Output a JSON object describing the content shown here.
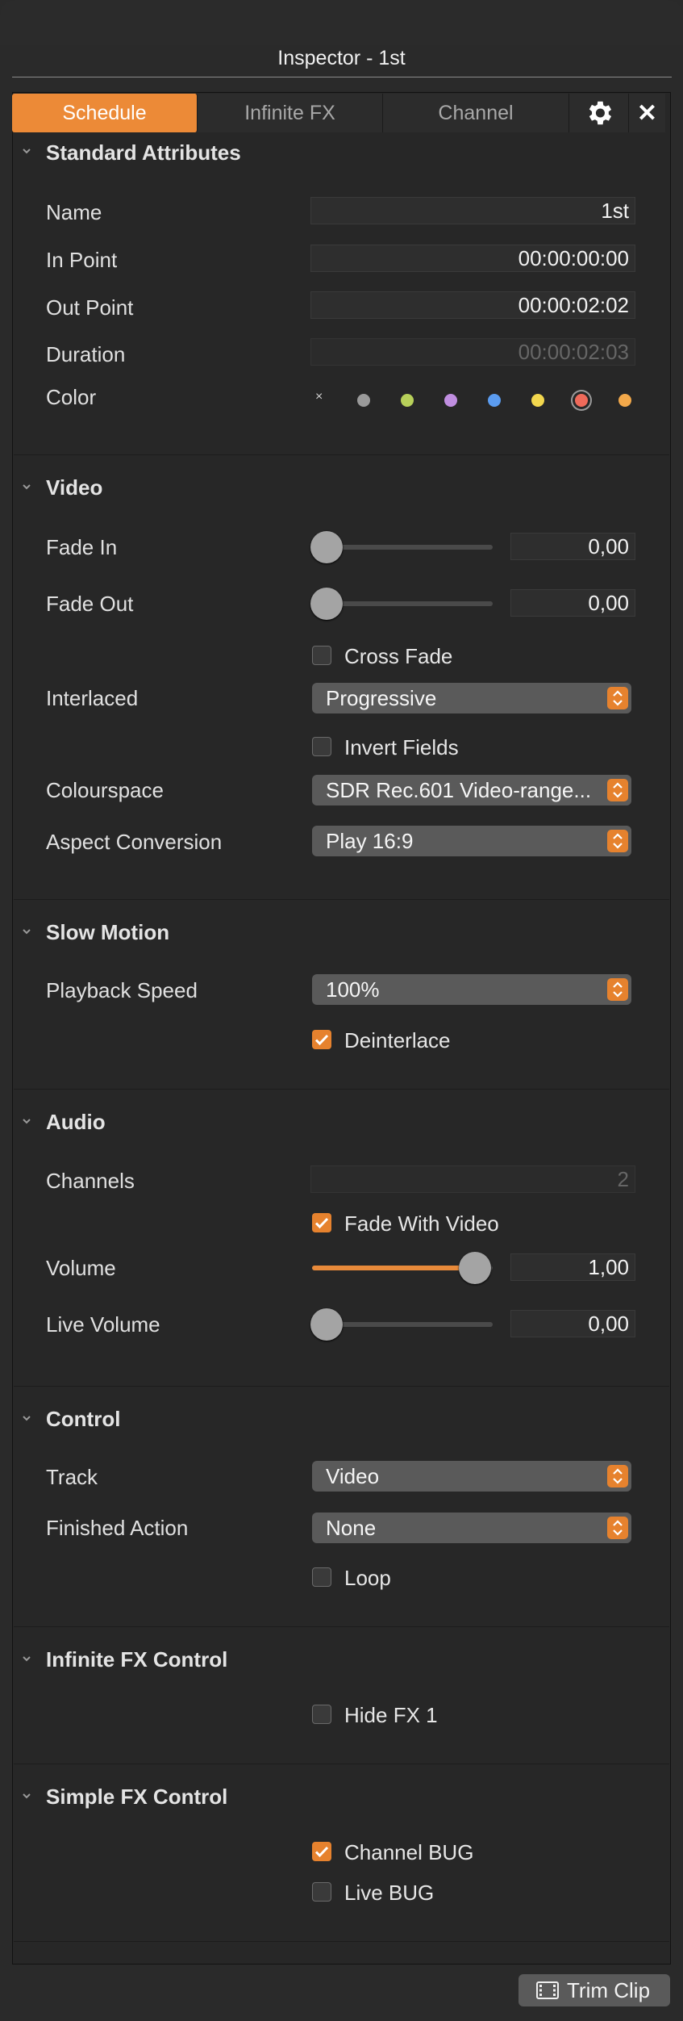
{
  "window": {
    "title": "Inspector - 1st"
  },
  "tabs": [
    {
      "label": "Schedule",
      "active": true
    },
    {
      "label": "Infinite FX",
      "active": false
    },
    {
      "label": "Channel",
      "active": false
    }
  ],
  "tab_icons": {
    "settings": "gear-icon",
    "close": "close-icon",
    "close_glyph": "✕"
  },
  "standard": {
    "title": "Standard Attributes",
    "name_label": "Name",
    "name_value": "1st",
    "in_label": "In Point",
    "in_value": "00:00:00:00",
    "out_label": "Out Point",
    "out_value": "00:00:02:02",
    "duration_label": "Duration",
    "duration_value": "00:00:02:03",
    "color_label": "Color",
    "color_none_glyph": "×",
    "colors": [
      "#9a9a9a",
      "#b7d05a",
      "#c08ee0",
      "#5b9cf0",
      "#f2d74e",
      "#ef6a5a",
      "#f2a84a"
    ],
    "selected_color": "#ef6a5a"
  },
  "video": {
    "title": "Video",
    "fade_in_label": "Fade In",
    "fade_in_value": "0,00",
    "fade_in_level": 0,
    "fade_out_label": "Fade Out",
    "fade_out_value": "0,00",
    "fade_out_level": 0,
    "cross_fade_label": "Cross Fade",
    "cross_fade_checked": false,
    "interlaced_label": "Interlaced",
    "interlaced_value": "Progressive",
    "invert_label": "Invert Fields",
    "invert_checked": false,
    "colourspace_label": "Colourspace",
    "colourspace_value": "SDR Rec.601 Video-range...",
    "aspect_label": "Aspect Conversion",
    "aspect_value": "Play 16:9"
  },
  "slow_motion": {
    "title": "Slow Motion",
    "speed_label": "Playback Speed",
    "speed_value": "100%",
    "deinterlace_label": "Deinterlace",
    "deinterlace_checked": true
  },
  "audio": {
    "title": "Audio",
    "channels_label": "Channels",
    "channels_value": "2",
    "fade_video_label": "Fade With Video",
    "fade_video_checked": true,
    "volume_label": "Volume",
    "volume_value": "1,00",
    "volume_level": 1,
    "live_volume_label": "Live Volume",
    "live_volume_value": "0,00",
    "live_volume_level": 0
  },
  "control": {
    "title": "Control",
    "track_label": "Track",
    "track_value": "Video",
    "finished_label": "Finished Action",
    "finished_value": "None",
    "loop_label": "Loop",
    "loop_checked": false
  },
  "infinite_fx": {
    "title": "Infinite FX Control",
    "hide_fx_label": "Hide FX 1",
    "hide_fx_checked": false
  },
  "simple_fx": {
    "title": "Simple FX Control",
    "channel_bug_label": "Channel BUG",
    "channel_bug_checked": true,
    "live_bug_label": "Live BUG",
    "live_bug_checked": false
  },
  "footer": {
    "trim_label": "Trim Clip",
    "trim_icon": "film-icon"
  },
  "colors": {
    "accent": "#ec8a37",
    "background": "#2a2a2a"
  }
}
